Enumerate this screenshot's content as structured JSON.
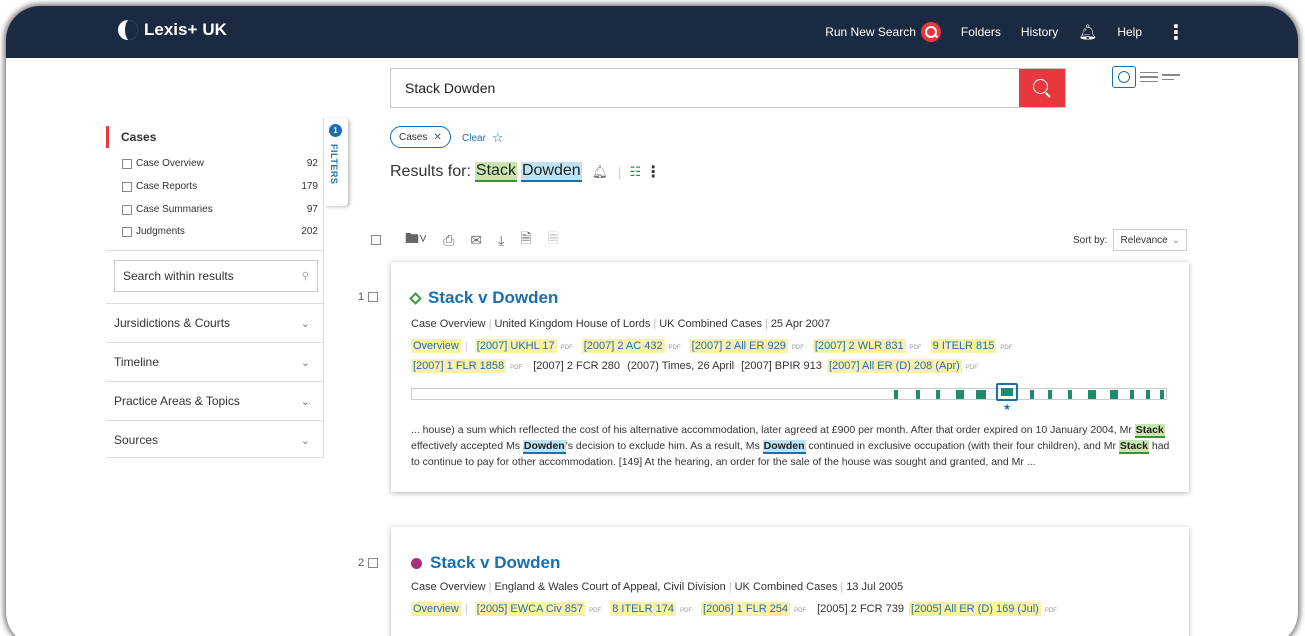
{
  "brand": {
    "name": "Lexis+",
    "suffix": "UK"
  },
  "nav": {
    "run_new_search": "Run New Search",
    "folders": "Folders",
    "history": "History",
    "help": "Help"
  },
  "search": {
    "value": "Stack Dowden"
  },
  "sidebar": {
    "cases_heading": "Cases",
    "facets": [
      {
        "label": "Case Overview",
        "count": "92"
      },
      {
        "label": "Case Reports",
        "count": "179"
      },
      {
        "label": "Case Summaries",
        "count": "97"
      },
      {
        "label": "Judgments",
        "count": "202"
      }
    ],
    "within_placeholder": "Search within results",
    "accordions": [
      "Jursidictions & Courts",
      "Timeline",
      "Practice Areas & Topics",
      "Sources"
    ],
    "filters_label": "FILTERS",
    "filters_count": "1"
  },
  "chips": {
    "cases": "Cases",
    "clear": "Clear"
  },
  "results": {
    "prefix": "Results for:",
    "term1": "Stack",
    "term2": "Dowden"
  },
  "sort": {
    "label": "Sort by:",
    "value": "Relevance"
  },
  "cards": [
    {
      "num": "1",
      "title": "Stack v Dowden",
      "meta": [
        "Case Overview",
        "United Kingdom House of Lords",
        "UK Combined Cases",
        "25 Apr 2007"
      ],
      "cits_line1": [
        "Overview",
        "[2007] UKHL 17",
        "[2007] 2 AC 432",
        "[2007] 2 All ER 929",
        "[2007] 2 WLR 831",
        "9 ITELR 815"
      ],
      "cits_line2": [
        "[2007] 1 FLR 1858",
        "[2007] 2 FCR 280",
        "(2007) Times, 26 April",
        "[2007] BPIR 913",
        "[2007] All ER (D) 208 (Apr)"
      ],
      "snippet": {
        "a": "... house) a sum which reflected the cost of his alternative accommodation, later agreed at £900 per month. After that order expired on 10 January 2004, Mr",
        "b": "Stack",
        "c": "effectively accepted Ms",
        "d": "Dowden",
        "e": "'s decision to exclude him. As a result, Ms",
        "f": "Dowden",
        "g": "continued in exclusive occupation (with their four children), and Mr",
        "h": "Stack",
        "i": "had to continue to pay for other accommodation. [149] At the hearing, an order for the sale of the house was sought and granted, and Mr ..."
      }
    },
    {
      "num": "2",
      "title": "Stack v Dowden",
      "meta": [
        "Case Overview",
        "England & Wales Court of Appeal, Civil Division",
        "UK Combined Cases",
        "13 Jul 2005"
      ],
      "cits_line1": [
        "Overview",
        "[2005] EWCA Civ 857",
        "8 ITELR 174",
        "[2006] 1 FLR 254",
        "[2005] 2 FCR 739",
        "[2005] All ER (D) 169 (Jul)"
      ]
    }
  ],
  "pdf_label": "PDF"
}
